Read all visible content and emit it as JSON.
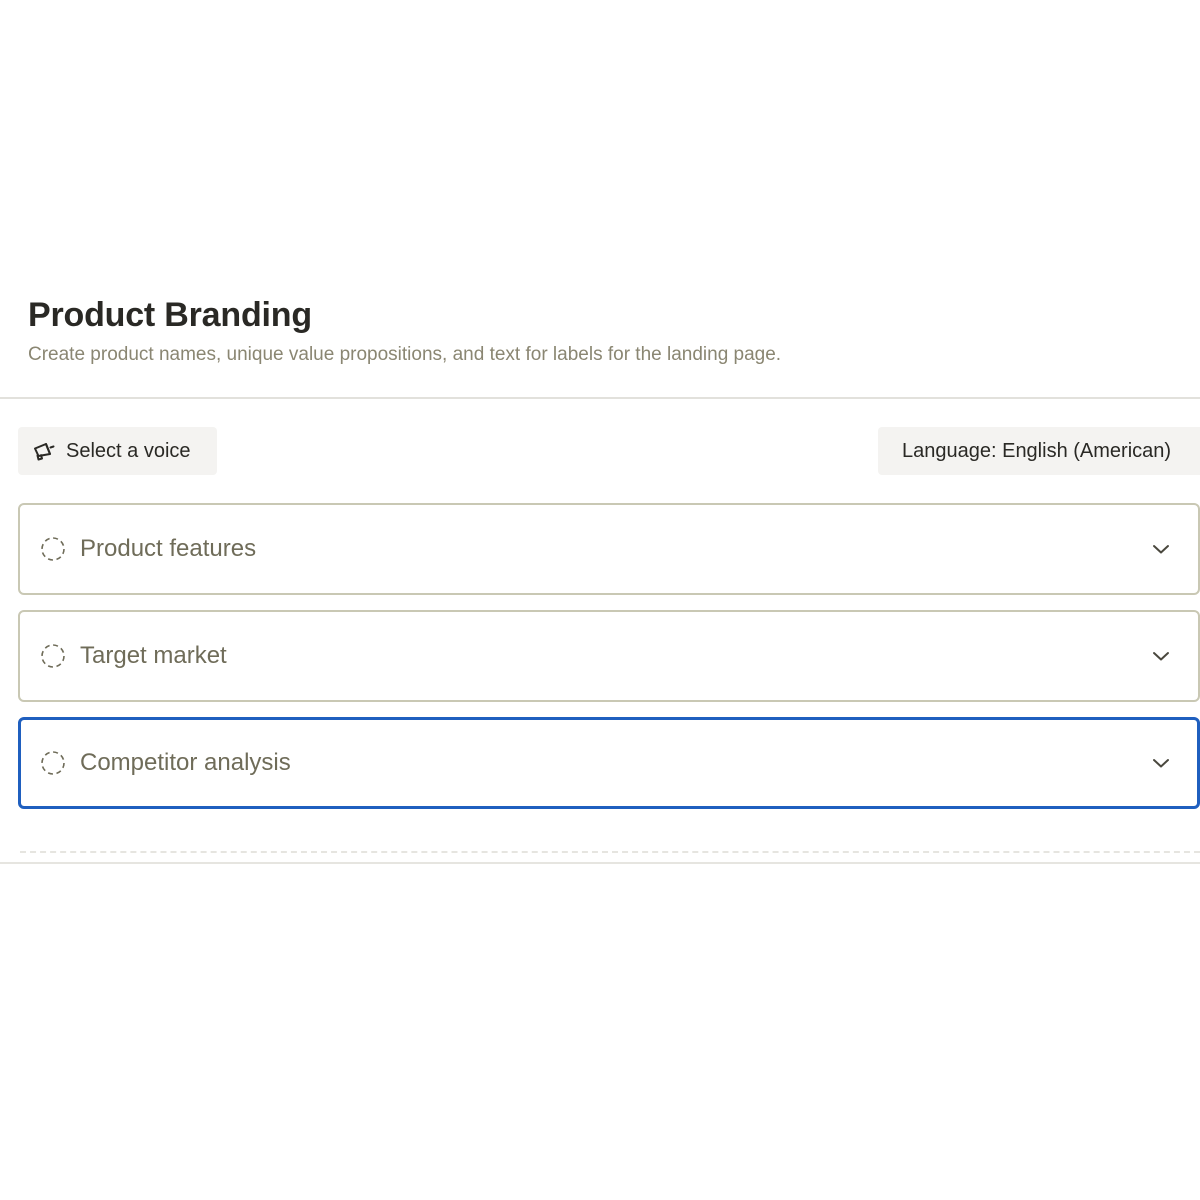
{
  "header": {
    "title": "Product Branding",
    "subtitle": "Create product names, unique value propositions, and text for labels for the landing page."
  },
  "toolbar": {
    "voice": {
      "icon": "megaphone-icon",
      "label": "Select a voice"
    },
    "language": {
      "label": "Language: English (American)"
    }
  },
  "sections": [
    {
      "label": "Product features",
      "status_icon": "dashed-circle-icon",
      "toggle_icon": "chevron-down-icon",
      "focused": false
    },
    {
      "label": "Target market",
      "status_icon": "dashed-circle-icon",
      "toggle_icon": "chevron-down-icon",
      "focused": false
    },
    {
      "label": "Competitor analysis",
      "status_icon": "dashed-circle-icon",
      "toggle_icon": "chevron-down-icon",
      "focused": true
    }
  ],
  "colors": {
    "focus_border": "#1f5fbf",
    "section_border": "#c9c8b4",
    "section_text": "#6f6c59",
    "subtitle_text": "#8a8672",
    "button_bg": "#f4f3f1"
  }
}
